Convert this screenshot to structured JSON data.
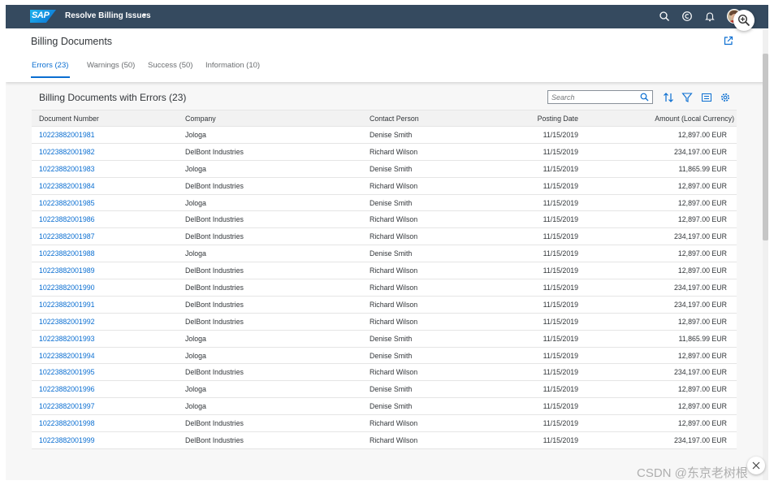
{
  "shell": {
    "logo_text": "SAP",
    "app_title": "Resolve Billing Issues",
    "caret": "▾"
  },
  "header": {
    "page_title": "Billing Documents",
    "tabs": [
      {
        "label": "Errors (23)"
      },
      {
        "label": "Warnings (50)"
      },
      {
        "label": "Success (50)"
      },
      {
        "label": "Information (10)"
      }
    ]
  },
  "table": {
    "title": "Billing Documents with Errors (23)",
    "search_placeholder": "Search",
    "columns": [
      "Document Number",
      "Company",
      "Contact Person",
      "Posting Date",
      "Amount (Local Currency)"
    ],
    "rows": [
      [
        "10223882001981",
        "Jologa",
        "Denise Smith",
        "11/15/2019",
        "12,897.00 EUR"
      ],
      [
        "10223882001982",
        "DelBont Industries",
        "Richard Wilson",
        "11/15/2019",
        "234,197.00 EUR"
      ],
      [
        "10223882001983",
        "Jologa",
        "Denise Smith",
        "11/15/2019",
        "11,865.99 EUR"
      ],
      [
        "10223882001984",
        "DelBont Industries",
        "Richard Wilson",
        "11/15/2019",
        "12,897.00 EUR"
      ],
      [
        "10223882001985",
        "Jologa",
        "Denise Smith",
        "11/15/2019",
        "12,897.00 EUR"
      ],
      [
        "10223882001986",
        "DelBont Industries",
        "Richard Wilson",
        "11/15/2019",
        "12,897.00 EUR"
      ],
      [
        "10223882001987",
        "DelBont Industries",
        "Richard Wilson",
        "11/15/2019",
        "234,197.00 EUR"
      ],
      [
        "10223882001988",
        "Jologa",
        "Denise Smith",
        "11/15/2019",
        "12,897.00 EUR"
      ],
      [
        "10223882001989",
        "DelBont Industries",
        "Richard Wilson",
        "11/15/2019",
        "12,897.00 EUR"
      ],
      [
        "10223882001990",
        "DelBont Industries",
        "Richard Wilson",
        "11/15/2019",
        "234,197.00 EUR"
      ],
      [
        "10223882001991",
        "DelBont Industries",
        "Richard Wilson",
        "11/15/2019",
        "234,197.00 EUR"
      ],
      [
        "10223882001992",
        "DelBont Industries",
        "Richard Wilson",
        "11/15/2019",
        "12,897.00 EUR"
      ],
      [
        "10223882001993",
        "Jologa",
        "Denise Smith",
        "11/15/2019",
        "11,865.99 EUR"
      ],
      [
        "10223882001994",
        "Jologa",
        "Denise Smith",
        "11/15/2019",
        "12,897.00 EUR"
      ],
      [
        "10223882001995",
        "DelBont Industries",
        "Richard Wilson",
        "11/15/2019",
        "234,197.00 EUR"
      ],
      [
        "10223882001996",
        "Jologa",
        "Denise Smith",
        "11/15/2019",
        "12,897.00 EUR"
      ],
      [
        "10223882001997",
        "Jologa",
        "Denise Smith",
        "11/15/2019",
        "12,897.00 EUR"
      ],
      [
        "10223882001998",
        "DelBont Industries",
        "Richard Wilson",
        "11/15/2019",
        "12,897.00 EUR"
      ],
      [
        "10223882001999",
        "DelBont Industries",
        "Richard Wilson",
        "11/15/2019",
        "234,197.00 EUR"
      ]
    ]
  },
  "icons": {
    "shell": [
      "search-icon",
      "help-icon",
      "notification-bell-icon",
      "user-avatar"
    ],
    "toolbar": [
      "sort-icon",
      "filter-icon",
      "group-icon",
      "settings-icon"
    ],
    "share": "share-icon",
    "zoom": "zoom-in-icon"
  },
  "colors": {
    "shell_bg": "#354a5f",
    "link": "#0a6ed1",
    "page_bg": "#f7f7f7"
  },
  "watermark": "CSDN @东京老树根"
}
